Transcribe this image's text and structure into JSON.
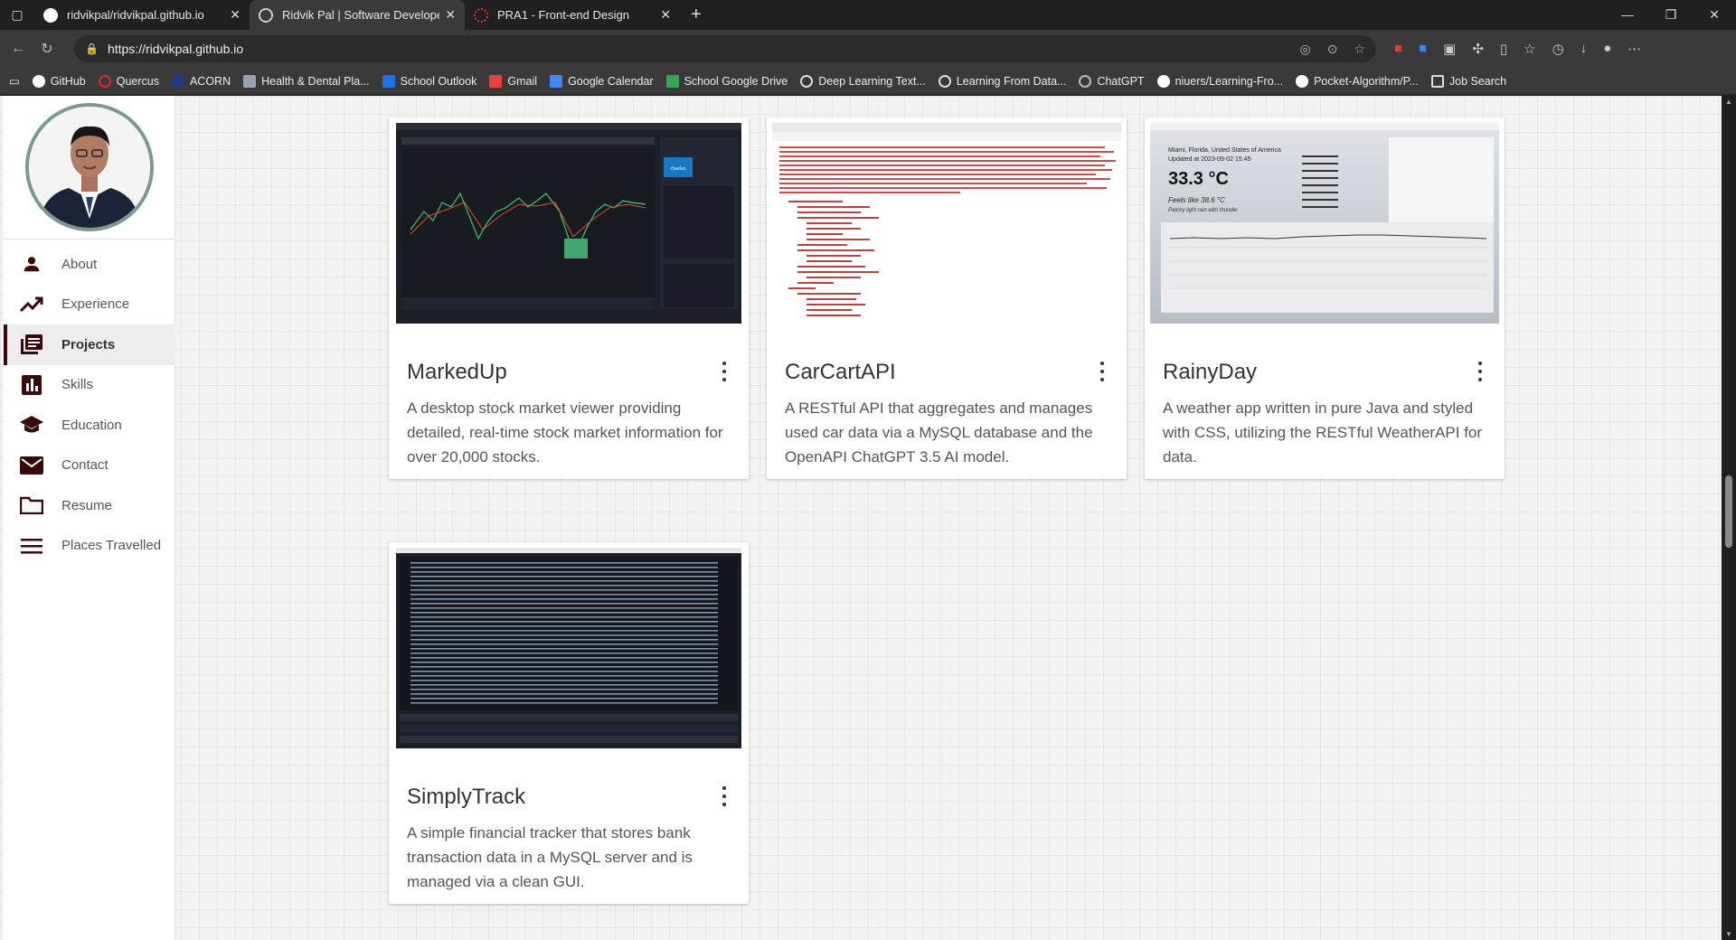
{
  "browser": {
    "tabs": [
      {
        "title": "ridvikpal/ridvikpal.github.io",
        "active": false,
        "favicon_color": "#ffffff"
      },
      {
        "title": "Ridvik Pal | Software Developer",
        "active": true,
        "favicon_color": "#cccccc"
      },
      {
        "title": "PRA1 - Front-end Design",
        "active": false,
        "favicon_color": "#e03a3a"
      }
    ],
    "url": "https://ridvikpal.github.io",
    "bookmarks": [
      {
        "label": "GitHub",
        "color": "#ffffff"
      },
      {
        "label": "Quercus",
        "color": "#e02b2b"
      },
      {
        "label": "ACORN",
        "color": "#1e3a8a"
      },
      {
        "label": "Health & Dental Pla...",
        "color": "#9aa0b0"
      },
      {
        "label": "School Outlook",
        "color": "#1a73e8"
      },
      {
        "label": "Gmail",
        "color": "#ea4335"
      },
      {
        "label": "Google Calendar",
        "color": "#4285f4"
      },
      {
        "label": "School Google Drive",
        "color": "#34a853"
      },
      {
        "label": "Deep Learning Text...",
        "color": "#dddddd"
      },
      {
        "label": "Learning From Data...",
        "color": "#dddddd"
      },
      {
        "label": "ChatGPT",
        "color": "#bbbbbb"
      },
      {
        "label": "niuers/Learning-Fro...",
        "color": "#ffffff"
      },
      {
        "label": "Pocket-Algorithm/P...",
        "color": "#ffffff"
      },
      {
        "label": "Job Search",
        "color": "#dddddd"
      }
    ]
  },
  "sidebar": {
    "items": [
      {
        "label": "About",
        "icon": "person-icon"
      },
      {
        "label": "Experience",
        "icon": "trending-up-icon"
      },
      {
        "label": "Projects",
        "icon": "library-books-icon",
        "active": true
      },
      {
        "label": "Skills",
        "icon": "bar-chart-icon"
      },
      {
        "label": "Education",
        "icon": "school-icon"
      },
      {
        "label": "Contact",
        "icon": "mail-icon"
      },
      {
        "label": "Resume",
        "icon": "folder-icon"
      },
      {
        "label": "Places Travelled",
        "icon": "menu-icon"
      }
    ]
  },
  "projects": [
    {
      "title": "MarkedUp",
      "description": "A desktop stock market viewer providing detailed, real-time stock market information for over 20,000 stocks."
    },
    {
      "title": "CarCartAPI",
      "description": "A RESTful API that aggregates and manages used car data via a MySQL database and the OpenAPI ChatGPT 3.5 AI model."
    },
    {
      "title": "RainyDay",
      "description": "A weather app written in pure Java and styled with CSS, utilizing the RESTful WeatherAPI for data."
    },
    {
      "title": "SimplyTrack",
      "description": "A simple financial tracker that stores bank transaction data in a MySQL server and is managed via a clean GUI."
    }
  ],
  "screenshot_text": {
    "rainyday_location": "Miami, Florida, United States of America",
    "rainyday_updated": "Updated at 2023-09-02 15:45",
    "rainyday_temp": "33.3 °C",
    "rainyday_feels": "Feels like 38.6 °C",
    "rainyday_cond": "Patchy light rain with thunder",
    "markedup_brand": "charles SCHWAB"
  }
}
